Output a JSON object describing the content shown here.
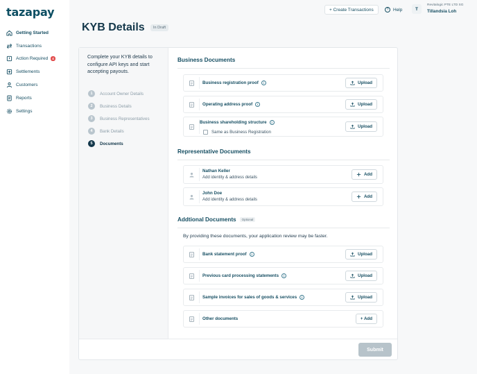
{
  "app": {
    "logo": "tazapay"
  },
  "sidebar": {
    "items": [
      {
        "label": "Getting Started",
        "icon": "home-icon",
        "active": true
      },
      {
        "label": "Transactions",
        "icon": "transactions-icon"
      },
      {
        "label": "Action Required",
        "icon": "action-required-icon",
        "badge": "4"
      },
      {
        "label": "Settlements",
        "icon": "settlements-icon"
      },
      {
        "label": "Customers",
        "icon": "customers-icon"
      },
      {
        "label": "Reports",
        "icon": "reports-icon"
      },
      {
        "label": "Settings",
        "icon": "settings-icon"
      }
    ]
  },
  "topbar": {
    "create_label": "+ Create Transactions",
    "help_label": "Help",
    "avatar_initial": "T",
    "org_name": "Revitalogic PTE LTD SG",
    "user_name": "Tillandsia Loh"
  },
  "page": {
    "title": "KYB Details",
    "status": "In Draft"
  },
  "left": {
    "intro": "Complete your KYB details to configure API keys and start accepting payouts.",
    "steps": [
      {
        "num": "1",
        "label": "Account Owner Details"
      },
      {
        "num": "2",
        "label": "Business Details"
      },
      {
        "num": "3",
        "label": "Business Representatives"
      },
      {
        "num": "4",
        "label": "Bank Details"
      },
      {
        "num": "5",
        "label": "Documents"
      }
    ]
  },
  "business_docs": {
    "title": "Business Documents",
    "items": [
      {
        "label": "Business registration proof",
        "action": "Upload"
      },
      {
        "label": "Operating address proof",
        "action": "Upload"
      },
      {
        "label": "Business shareholding structure",
        "action": "Upload",
        "checkbox_label": "Same as Business Registration"
      }
    ]
  },
  "rep_docs": {
    "title": "Representative Documents",
    "items": [
      {
        "name": "Nathan Keller",
        "sub": "Add identity & address details",
        "action": "Add"
      },
      {
        "name": "John Doe",
        "sub": "Add identity & address details",
        "action": "Add"
      }
    ]
  },
  "additional_docs": {
    "title": "Addtional Documents",
    "optional": "Optional",
    "description": "By providing these documents, your application review may be faster.",
    "items": [
      {
        "label": "Bank statement proof",
        "action": "Upload"
      },
      {
        "label": "Previous card processing statements",
        "action": "Upload"
      },
      {
        "label": "Sample invoices for sales of goods & services",
        "action": "Upload"
      },
      {
        "label": "Other documents",
        "action": "+ Add"
      }
    ]
  },
  "footer": {
    "submit_label": "Submit"
  },
  "colors": {
    "brand": "#174f63",
    "badge": "#e24c4c",
    "disabled": "#b7c3ca"
  }
}
